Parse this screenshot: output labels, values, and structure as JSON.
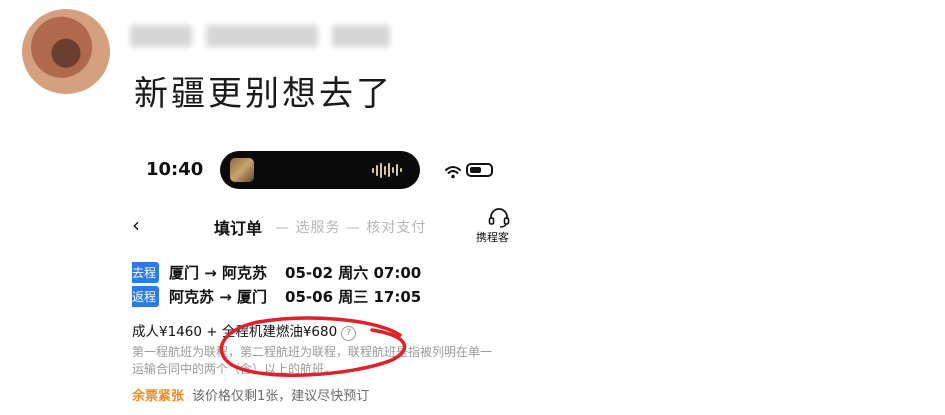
{
  "post": {
    "avatar_icon": "avatar-blurred",
    "text": "新疆更别想去了"
  },
  "phone": {
    "status": {
      "time": "10:40",
      "island_icon": "now-playing-thumbnail",
      "wifi_icon": "wifi-icon",
      "battery_icon": "battery-icon"
    },
    "nav": {
      "back_icon": "chevron-left-icon",
      "step_active": "填订单",
      "steps_rest": "— 选服务 — 核对支付",
      "service_icon": "customer-service-headset-icon",
      "service_label": "携程客"
    },
    "trips": [
      {
        "tag": "去程",
        "route": "厦门 → 阿克苏",
        "time": "05-02 周六 07:00"
      },
      {
        "tag": "返程",
        "route": "阿克苏 → 厦门",
        "time": "05-06 周三 17:05"
      }
    ],
    "price": {
      "line": "成人¥1460 + 全程机建燃油¥680"
    },
    "notes": [
      "第一程航班为联程，第二程航班为联程，联程航班是指被列明在单一",
      "运输合同中的两个（含）以上的航班。"
    ],
    "alert": {
      "tag": "余票紧张",
      "text": "该价格仅剩1张，建议尽快预订"
    },
    "accent_color": "#2b7bf0",
    "alert_color": "#f58a1f",
    "annotation_color": "#e0202a"
  }
}
